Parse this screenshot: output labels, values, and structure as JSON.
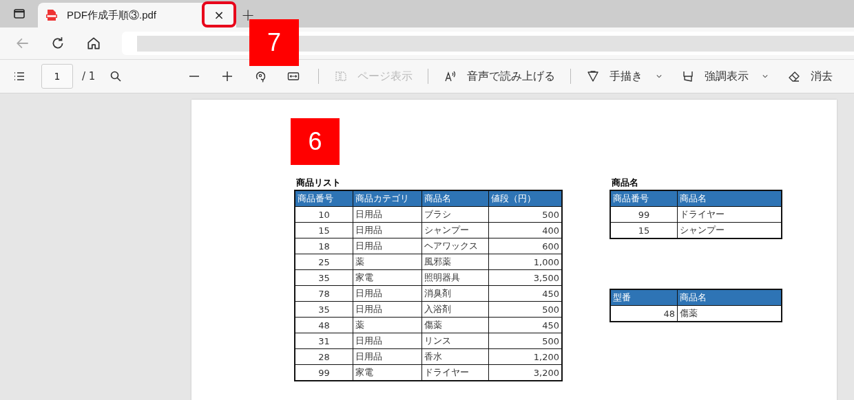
{
  "tabs": [
    {
      "title": "PDF作成手順③.pdf",
      "selected": true,
      "close": {
        "label": "×",
        "highlighted": true
      }
    }
  ],
  "new_tab": "+",
  "pdf_toolbar": {
    "page_number": "1",
    "page_count": "/ 1",
    "items": [
      {
        "kind": "button"
      },
      {
        "kind": "button"
      },
      {
        "kind": "button"
      },
      {
        "kind": "button"
      },
      {
        "kind": "divider"
      },
      {
        "kind": "labeled",
        "label": "ページ表示",
        "disabled": true
      },
      {
        "kind": "divider"
      },
      {
        "kind": "labeled",
        "label": "音声で読み上げる",
        "disabled": false
      },
      {
        "kind": "divider"
      },
      {
        "kind": "labeled",
        "label": "手描き",
        "disabled": false,
        "dropdown": true
      },
      {
        "kind": "labeled",
        "label": "強調表示",
        "disabled": false,
        "dropdown": true
      },
      {
        "kind": "labeled",
        "label": "消去",
        "disabled": false
      }
    ]
  },
  "annotations": [
    {
      "label": "7"
    },
    {
      "label": "6"
    }
  ],
  "document": {
    "tables": [
      {
        "title": "商品リスト",
        "columns": [
          {
            "label": "商品番号",
            "kind": "id"
          },
          {
            "label": "商品カテゴリ",
            "kind": "text"
          },
          {
            "label": "商品名",
            "kind": "text"
          },
          {
            "label": "値段（円）",
            "kind": "amount"
          }
        ],
        "rows": [
          [
            "10",
            "日用品",
            "ブラシ",
            "500"
          ],
          [
            "15",
            "日用品",
            "シャンプー",
            "400"
          ],
          [
            "18",
            "日用品",
            "ヘアワックス",
            "600"
          ],
          [
            "25",
            "薬",
            "風邪薬",
            "1,000"
          ],
          [
            "35",
            "家電",
            "照明器具",
            "3,500"
          ],
          [
            "78",
            "日用品",
            "消臭剤",
            "450"
          ],
          [
            "35",
            "日用品",
            "入浴剤",
            "500"
          ],
          [
            "48",
            "薬",
            "傷薬",
            "450"
          ],
          [
            "31",
            "日用品",
            "リンス",
            "500"
          ],
          [
            "28",
            "日用品",
            "香水",
            "1,200"
          ],
          [
            "99",
            "家電",
            "ドライヤー",
            "3,200"
          ]
        ]
      },
      {
        "title": "商品名",
        "columns": [
          {
            "label": "商品番号",
            "kind": "id"
          },
          {
            "label": "商品名",
            "kind": "text"
          }
        ],
        "rows": [
          [
            "99",
            "ドライヤー"
          ],
          [
            "15",
            "シャンプー"
          ]
        ]
      },
      {
        "columns": [
          {
            "label": "型番",
            "kind": "amount"
          },
          {
            "label": "商品名",
            "kind": "text"
          }
        ],
        "rows": [
          [
            "48",
            "傷薬"
          ]
        ]
      }
    ]
  }
}
